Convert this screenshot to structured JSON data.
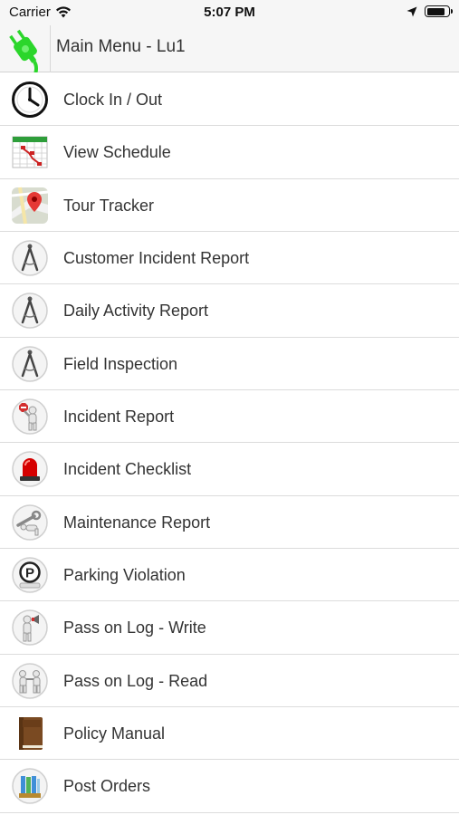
{
  "status_bar": {
    "carrier": "Carrier",
    "time": "5:07 PM",
    "battery_level": 0.85
  },
  "nav": {
    "title": "Main Menu - Lu1",
    "logo_icon": "plug-icon",
    "logo_color": "#22dd22"
  },
  "menu": {
    "items": [
      {
        "label": "Clock In / Out",
        "icon": "clock-icon"
      },
      {
        "label": "View Schedule",
        "icon": "calendar-icon"
      },
      {
        "label": "Tour Tracker",
        "icon": "map-pin-icon"
      },
      {
        "label": "Customer Incident Report",
        "icon": "compass-icon"
      },
      {
        "label": "Daily Activity Report",
        "icon": "compass-icon"
      },
      {
        "label": "Field Inspection",
        "icon": "compass-icon"
      },
      {
        "label": "Incident Report",
        "icon": "stop-sign-person-icon"
      },
      {
        "label": "Incident Checklist",
        "icon": "siren-icon"
      },
      {
        "label": "Maintenance Report",
        "icon": "wrench-person-icon"
      },
      {
        "label": "Parking Violation",
        "icon": "parking-icon"
      },
      {
        "label": "Pass on Log - Write",
        "icon": "megaphone-person-icon"
      },
      {
        "label": "Pass on Log - Read",
        "icon": "two-persons-icon"
      },
      {
        "label": "Policy Manual",
        "icon": "book-icon"
      },
      {
        "label": "Post Orders",
        "icon": "binders-icon"
      }
    ]
  }
}
